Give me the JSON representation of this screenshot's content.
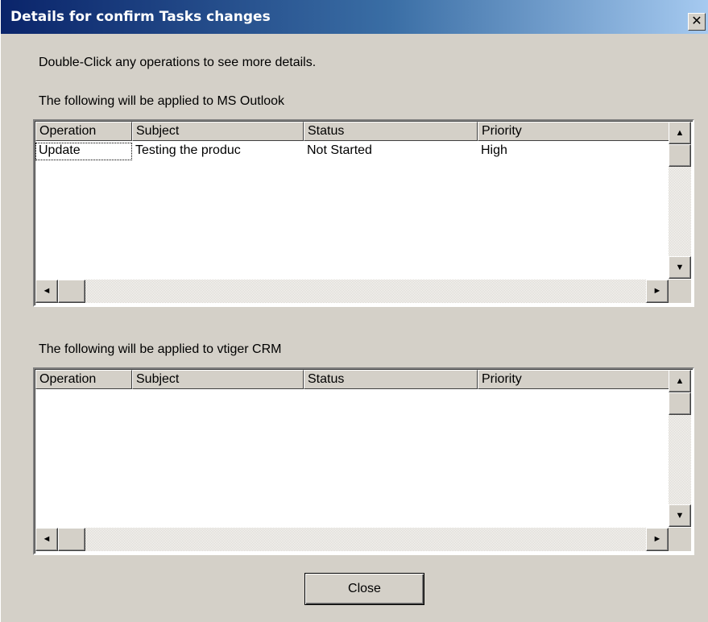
{
  "window": {
    "title": "Details for confirm Tasks changes",
    "close_glyph": "✕"
  },
  "instructions": "Double-Click any operations to see more details.",
  "outlook_section": {
    "label": "The following will be applied to MS Outlook",
    "columns": [
      "Operation",
      "Subject",
      "Status",
      "Priority"
    ],
    "rows": [
      {
        "operation": "Update",
        "subject": "Testing the produc",
        "status": "Not Started",
        "priority": "High"
      }
    ]
  },
  "vtiger_section": {
    "label": "The following will be applied to vtiger CRM",
    "columns": [
      "Operation",
      "Subject",
      "Status",
      "Priority"
    ],
    "rows": []
  },
  "scroll_glyphs": {
    "up": "▲",
    "down": "▼",
    "left": "◄",
    "right": "►"
  },
  "footer": {
    "close_label": "Close"
  }
}
